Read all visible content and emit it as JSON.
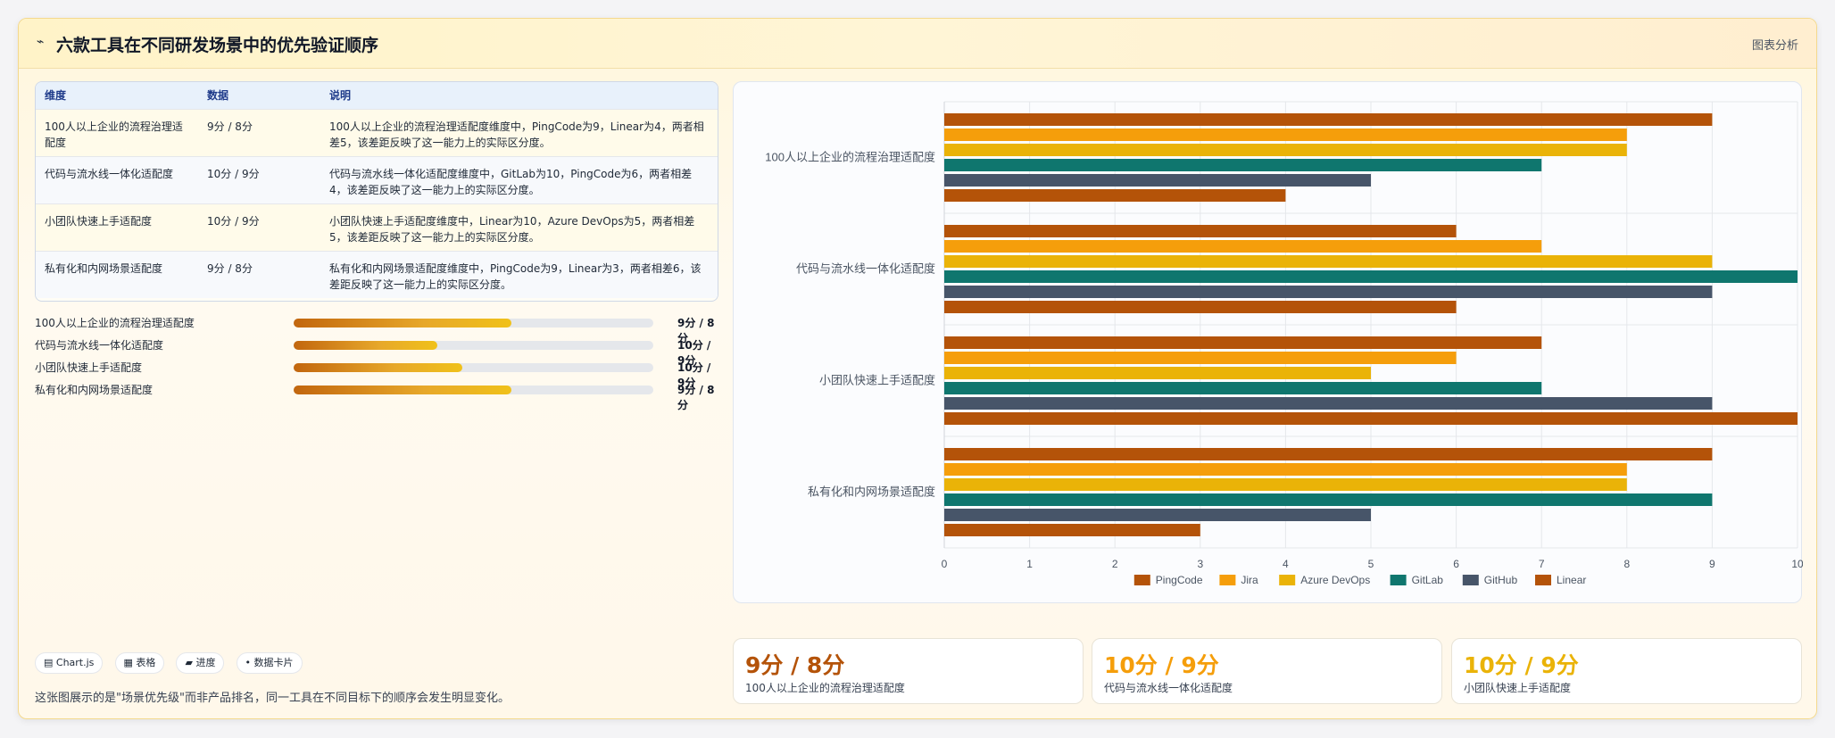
{
  "header": {
    "icon": "chart-line-icon",
    "icon_glyph": "⌁",
    "title": "六款工具在不同研发场景中的优先验证顺序",
    "right_label": "图表分析"
  },
  "table": {
    "headers": [
      "维度",
      "数据",
      "说明"
    ],
    "rows": [
      {
        "dimension": "100人以上企业的流程治理适配度",
        "data": "9分 / 8分",
        "note": "100人以上企业的流程治理适配度维度中，PingCode为9，Linear为4，两者相差5，该差距反映了这一能力上的实际区分度。"
      },
      {
        "dimension": "代码与流水线一体化适配度",
        "data": "10分 / 9分",
        "note": "代码与流水线一体化适配度维度中，GitLab为10，PingCode为6，两者相差4，该差距反映了这一能力上的实际区分度。"
      },
      {
        "dimension": "小团队快速上手适配度",
        "data": "10分 / 9分",
        "note": "小团队快速上手适配度维度中，Linear为10，Azure DevOps为5，两者相差5，该差距反映了这一能力上的实际区分度。"
      },
      {
        "dimension": "私有化和内网场景适配度",
        "data": "9分 / 8分",
        "note": "私有化和内网场景适配度维度中，PingCode为9，Linear为3，两者相差6，该差距反映了这一能力上的实际区分度。"
      }
    ]
  },
  "progress": [
    {
      "label": "100人以上企业的流程治理适配度",
      "fraction": 0.605,
      "value": "9分 / 8分"
    },
    {
      "label": "代码与流水线一体化适配度",
      "fraction": 0.4,
      "value": "10分 / 9分"
    },
    {
      "label": "小团队快速上手适配度",
      "fraction": 0.47,
      "value": "10分 / 9分"
    },
    {
      "label": "私有化和内网场景适配度",
      "fraction": 0.605,
      "value": "9分 / 8分"
    }
  ],
  "tags": [
    "▤ Chart.js",
    "▦ 表格",
    "▰ 进度",
    "• 数据卡片"
  ],
  "footer_note": "这张图展示的是\"场景优先级\"而非产品排名，同一工具在不同目标下的顺序会发生明显变化。",
  "kpis": [
    {
      "value": "9分 / 8分",
      "label": "100人以上企业的流程治理适配度",
      "color": "#b45309"
    },
    {
      "value": "10分 / 9分",
      "label": "代码与流水线一体化适配度",
      "color": "#f59e0b"
    },
    {
      "value": "10分 / 9分",
      "label": "小团队快速上手适配度",
      "color": "#eab308"
    }
  ],
  "chart_data": {
    "type": "bar",
    "orientation": "horizontal",
    "categories": [
      "100人以上企业的流程治理适配度",
      "代码与流水线一体化适配度",
      "小团队快速上手适配度",
      "私有化和内网场景适配度"
    ],
    "series": [
      {
        "name": "PingCode",
        "color": "#b45309",
        "values": [
          9,
          6,
          7,
          9
        ]
      },
      {
        "name": "Jira",
        "color": "#f59e0b",
        "values": [
          8,
          7,
          6,
          8
        ]
      },
      {
        "name": "Azure DevOps",
        "color": "#eab308",
        "values": [
          8,
          9,
          5,
          8
        ]
      },
      {
        "name": "GitLab",
        "color": "#0f766e",
        "values": [
          7,
          10,
          7,
          9
        ]
      },
      {
        "name": "GitHub",
        "color": "#475569",
        "values": [
          5,
          9,
          9,
          5
        ]
      },
      {
        "name": "Linear",
        "color": "#b45309",
        "values": [
          4,
          6,
          10,
          3
        ]
      }
    ],
    "xlim": [
      0,
      10
    ],
    "xticks": [
      0,
      1,
      2,
      3,
      4,
      5,
      6,
      7,
      8,
      9,
      10
    ],
    "grid": true,
    "legend": "bottom"
  }
}
